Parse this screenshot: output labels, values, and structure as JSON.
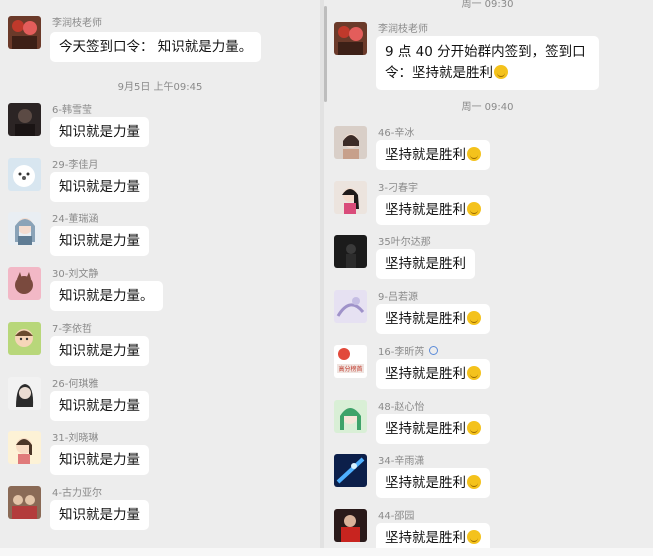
{
  "left": {
    "teacher": {
      "name": "李润枝老师",
      "text": "今天签到口令： 知识就是力量。"
    },
    "timestamp": "9月5日 上午09:45",
    "messages": [
      {
        "name": "6-韩雪莹",
        "text": "知识就是力量",
        "avatar": "avatar-dark-portrait"
      },
      {
        "name": "29-李佳月",
        "text": "知识就是力量",
        "avatar": "avatar-white-bear"
      },
      {
        "name": "24-董瑞涵",
        "text": "知识就是力量",
        "avatar": "avatar-anime-girl"
      },
      {
        "name": "30-刘文静",
        "text": "知识就是力量。",
        "avatar": "avatar-pink-cat"
      },
      {
        "name": "7-李依哲",
        "text": "知识就是力量",
        "avatar": "avatar-cartoon-kid"
      },
      {
        "name": "26-何琪雅",
        "text": "知识就是力量",
        "avatar": "avatar-sketch-girl"
      },
      {
        "name": "31-刘晓琳",
        "text": "知识就是力量",
        "avatar": "avatar-cartoon-girl"
      },
      {
        "name": "4-古力亚尔",
        "text": "知识就是力量",
        "avatar": "avatar-family-photo"
      }
    ]
  },
  "right": {
    "top_timestamp": "周一 09:30",
    "teacher": {
      "name": "李润枝老师",
      "text": "9 点 40 分开始群内签到，签到口令：坚持就是胜利"
    },
    "timestamp": "周一 09:40",
    "messages": [
      {
        "name": "46-辛冰",
        "text": "坚持就是胜利",
        "emoji": true,
        "avatar": "avatar-girl-photo"
      },
      {
        "name": "3-刁春宇",
        "text": "坚持就是胜利",
        "emoji": true,
        "avatar": "avatar-woman-photo"
      },
      {
        "name": "35叶尔达那",
        "text": "坚持就是胜利",
        "emoji": false,
        "avatar": "avatar-dark-figure"
      },
      {
        "name": "9-吕若源",
        "text": "坚持就是胜利",
        "emoji": true,
        "avatar": "avatar-lilac-art"
      },
      {
        "name": "16-李昕芮",
        "text": "坚持就是胜利",
        "emoji": true,
        "avatar": "avatar-poster",
        "avatar_caption": "高分榜首"
      },
      {
        "name": "48-赵心怡",
        "text": "坚持就是胜利",
        "emoji": true,
        "avatar": "avatar-green-fairy"
      },
      {
        "name": "34-辛雨潇",
        "text": "坚持就是胜利",
        "emoji": true,
        "avatar": "avatar-blue-galaxy"
      },
      {
        "name": "44-邵园",
        "text": "坚持就是胜利",
        "emoji": true,
        "avatar": "avatar-red-jersey"
      }
    ]
  },
  "colors": {
    "background": "#ededed",
    "bubble": "#ffffff",
    "meta_text": "#8a8a8a"
  }
}
